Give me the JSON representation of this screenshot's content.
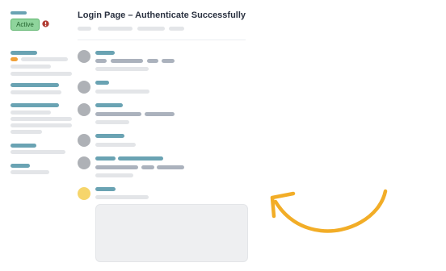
{
  "header": {
    "status_label": "Active",
    "title": "Login Page – Authenticate Successfully"
  },
  "colors": {
    "accent_teal": "#6aa3b3",
    "active_green": "#8fd49c",
    "warning_red": "#c0392b",
    "highlight_orange": "#f1a13a",
    "arrow_yellow": "#f2ad27"
  },
  "icons": {
    "header_status": "alert-icon",
    "annotation": "curved-arrow-icon"
  }
}
